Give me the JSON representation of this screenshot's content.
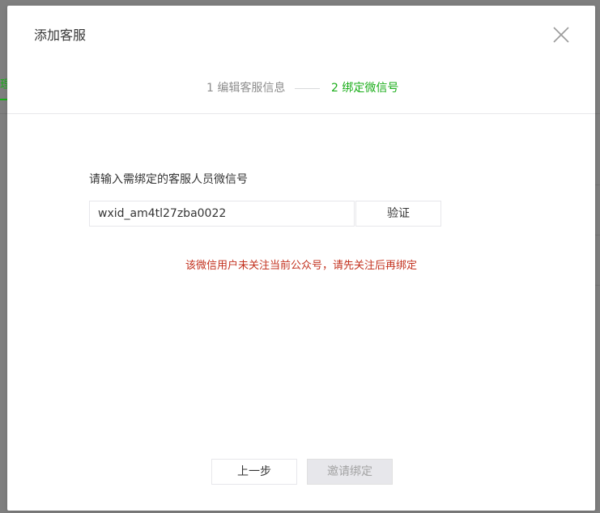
{
  "backdrop": {
    "tab_fragment": "理"
  },
  "dialog": {
    "title": "添加客服",
    "close_icon": "close-icon"
  },
  "stepper": {
    "step1_label": "1 编辑客服信息",
    "step2_label": "2 绑定微信号",
    "active_step": 2
  },
  "form": {
    "label": "请输入需绑定的客服人员微信号",
    "wechat_id_value": "wxid_am4tl27zba0022",
    "verify_label": "验证",
    "error_message": "该微信用户未关注当前公众号，请先关注后再绑定"
  },
  "footer": {
    "prev_label": "上一步",
    "invite_label": "邀请绑定",
    "invite_disabled": true
  },
  "colors": {
    "accent_green": "#1aad19",
    "error_red": "#c3321f",
    "overlay": "#7f7f7f"
  }
}
